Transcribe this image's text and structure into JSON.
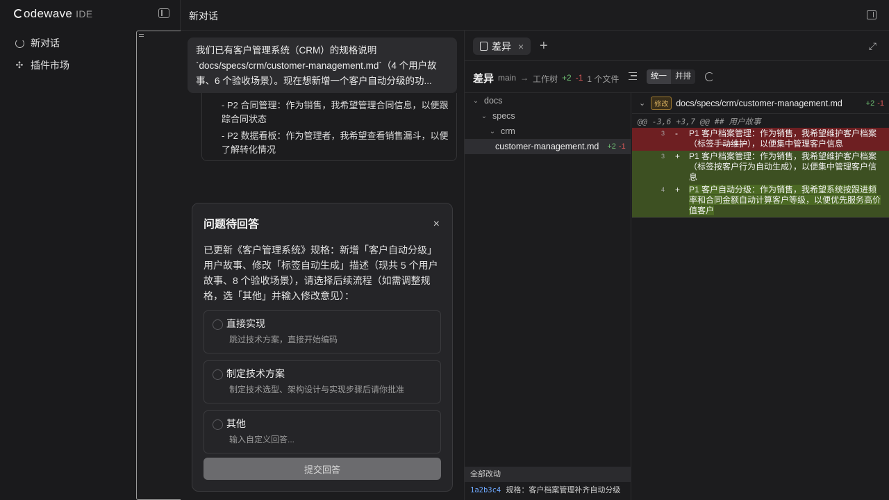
{
  "sidebar": {
    "brand_main": "odewave",
    "brand_ide": "IDE",
    "items": [
      {
        "label": "新对话",
        "icon": "refresh-icon"
      },
      {
        "label": "插件市场",
        "icon": "puzzle-icon"
      }
    ]
  },
  "header": {
    "title": "新对话"
  },
  "chat": {
    "user_message_lines": [
      "我们已有客户管理系统（CRM）的规格说明",
      "`docs/specs/crm/customer-management.md`（4 个用户故",
      "事、6 个验收场景）。现在想新增一个客户自动分级的功..."
    ],
    "reply_lines": [
      "- P2 合同管理：作为销售，我希望管理合同信息，以便跟踪合同状态",
      "- P2 数据看板：作为管理者，我希望查看销售漏斗，以便了解转化情况"
    ]
  },
  "modal": {
    "title": "问题待回答",
    "close": "×",
    "description": "已更新《客户管理系统》规格：新增「客户自动分级」用户故事、修改「标签自动生成」描述（现共 5 个用户故事、8 个验收场景），请选择后续流程（如需调整规格，选「其他」并输入修改意见）：",
    "options": [
      {
        "title": "直接实现",
        "subtitle": "跳过技术方案，直接开始编码"
      },
      {
        "title": "制定技术方案",
        "subtitle": "制定技术选型、架构设计与实现步骤后请你批准"
      },
      {
        "title": "其他",
        "subtitle": "输入自定义回答..."
      }
    ],
    "submit": "提交回答"
  },
  "diff": {
    "tab_label": "差异",
    "tab_close": "×",
    "add_tab": "+",
    "heading": "差异",
    "branch": "main",
    "arrow": "→",
    "worktree": "工作树",
    "added": "+2",
    "removed": "-1",
    "file_count": "1 个文件",
    "view_unified": "统一",
    "view_split": "并排",
    "tree": [
      {
        "name": "docs",
        "depth": 0,
        "folder": true
      },
      {
        "name": "specs",
        "depth": 1,
        "folder": true
      },
      {
        "name": "crm",
        "depth": 2,
        "folder": true
      },
      {
        "name": "customer-management.md",
        "depth": 3,
        "folder": false,
        "added": "+2",
        "removed": "-1"
      }
    ],
    "all_changes": "全部改动",
    "commit_hash": "1a2b3c4",
    "commit_msg": "规格：客户档案管理补齐自动分级",
    "file": {
      "badge": "修改",
      "path": "docs/specs/crm/customer-management.md",
      "added": "+2",
      "removed": "-1",
      "hunk": "@@ -3,6 +3,7 @@ ## 用户故事",
      "lines": [
        {
          "num": "3",
          "sign": "-",
          "type": "del",
          "pre": "P1 客户档案管理：作为销售，我希望维护客户档案（标签",
          "mark": "手动维护",
          "post": "），以便集中管理客户信息"
        },
        {
          "num": "3",
          "sign": "+",
          "type": "add",
          "pre": "P1 客户档案管理：作为销售，我希望维护客户档案（标签",
          "mark": "按客户行为自动生成",
          "post": "），以便集中管理客户信息"
        },
        {
          "num": "4",
          "sign": "+",
          "type": "add",
          "pre": "",
          "mark": "P1 客户自动分级：作为销售，我希望系统按跟进频率和合同金额自动计算客户等级，以便优先服务高价值客户",
          "post": ""
        }
      ]
    }
  }
}
